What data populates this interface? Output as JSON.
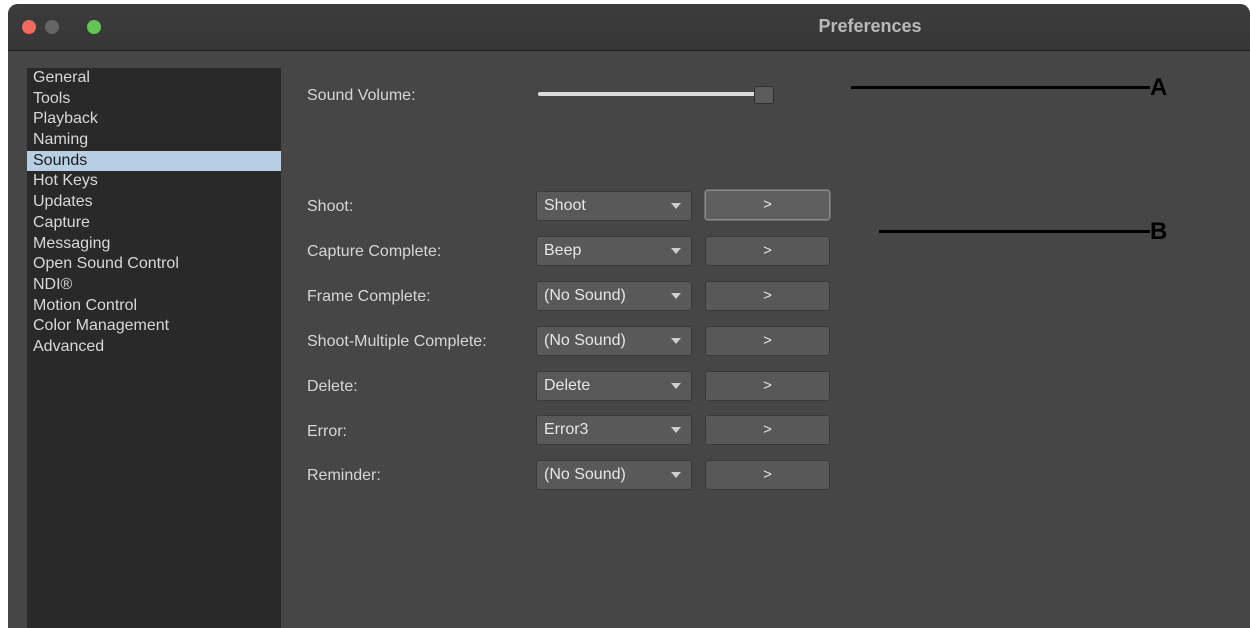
{
  "window": {
    "title": "Preferences"
  },
  "sidebar": {
    "items": [
      {
        "label": "General"
      },
      {
        "label": "Tools"
      },
      {
        "label": "Playback"
      },
      {
        "label": "Naming"
      },
      {
        "label": "Sounds",
        "selected": true
      },
      {
        "label": "Hot Keys"
      },
      {
        "label": "Updates"
      },
      {
        "label": "Capture"
      },
      {
        "label": "Messaging"
      },
      {
        "label": "Open Sound Control"
      },
      {
        "label": "NDI®"
      },
      {
        "label": "Motion Control"
      },
      {
        "label": "Color Management"
      },
      {
        "label": "Advanced"
      }
    ]
  },
  "volume": {
    "label": "Sound Volume:",
    "level_fraction": 0.97
  },
  "sounds": {
    "play_label": ">",
    "rows": [
      {
        "label": "Shoot:",
        "value": "Shoot"
      },
      {
        "label": "Capture Complete:",
        "value": "Beep"
      },
      {
        "label": "Frame Complete:",
        "value": "(No Sound)"
      },
      {
        "label": "Shoot-Multiple Complete:",
        "value": "(No Sound)"
      },
      {
        "label": "Delete:",
        "value": "Delete"
      },
      {
        "label": "Error:",
        "value": "Error3"
      },
      {
        "label": "Reminder:",
        "value": "(No Sound)"
      }
    ]
  },
  "callouts": {
    "a": "A",
    "b": "B"
  },
  "colors": {
    "selection": "#b8cfe3",
    "window_bg": "#464646",
    "sidebar_bg": "#292929"
  }
}
